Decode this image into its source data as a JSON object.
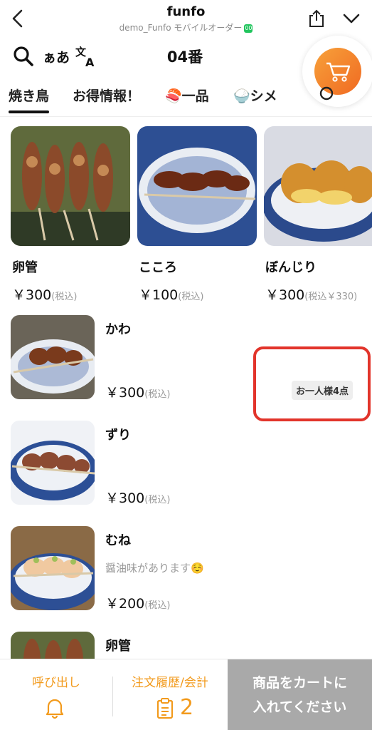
{
  "header": {
    "title": "funfo",
    "subtitle": "demo_Funfo モバイルオーダー",
    "badge": "00"
  },
  "toolbar": {
    "lang_label": "ぁあ",
    "table_number": "04番"
  },
  "tabs": [
    {
      "label": "焼き鳥",
      "active": true
    },
    {
      "label": "お得情報！",
      "active": false
    },
    {
      "label": "🍣一品",
      "active": false
    },
    {
      "label": "🍚シメ",
      "active": false
    }
  ],
  "featured": [
    {
      "name": "卵管",
      "price": "￥300",
      "tax": "(税込)"
    },
    {
      "name": "こころ",
      "price": "￥100",
      "tax": "(税込)"
    },
    {
      "name": "ぼんじり",
      "price": "￥300",
      "tax": "(税込￥330)"
    }
  ],
  "items": [
    {
      "name": "かわ",
      "desc": "",
      "price": "￥300",
      "tax": "(税込)",
      "limit": "お一人様4点"
    },
    {
      "name": "ずり",
      "desc": "",
      "price": "￥300",
      "tax": "(税込)"
    },
    {
      "name": "むね",
      "desc": "醤油味があります☺️",
      "price": "￥200",
      "tax": "(税込)"
    },
    {
      "name": "卵管",
      "desc": "",
      "price": "",
      "tax": ""
    }
  ],
  "bottom": {
    "call_label": "呼び出し",
    "history_label": "注文履歴/会計",
    "history_count": "2",
    "add_to_cart_line1": "商品をカートに",
    "add_to_cart_line2": "入れてください"
  },
  "colors": {
    "accent": "#f29a1c",
    "cart_gradient_start": "#f7a13a",
    "cart_gradient_end": "#f06a22",
    "highlight_border": "#e2342b",
    "disabled_button": "#a9a9a9"
  }
}
